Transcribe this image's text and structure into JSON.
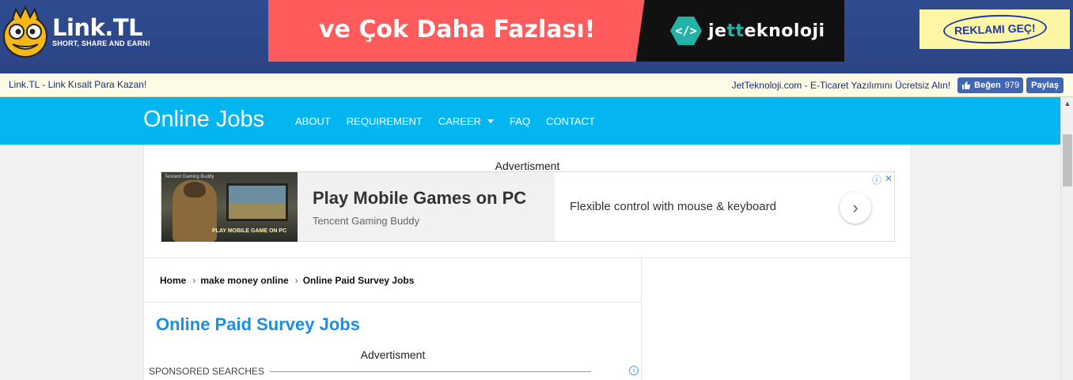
{
  "linktl": {
    "logo_title": "Link.TL",
    "logo_tagline": "SHORT, SHARE AND EARN!",
    "banner": {
      "headline": "ve Çok Daha Fazlası!",
      "brand_icon": "</>",
      "brand_pre": "je",
      "brand_accent": "tt",
      "brand_post": "eknoloji"
    },
    "skip_ad_label": "REKLAMI GEÇ!",
    "subbar_left": "Link.TL - Link Kısalt Para Kazan!",
    "subbar_link": "JetTeknoloji.com",
    "subbar_text": " - E-Ticaret Yazılımını Ücretsiz Alın!",
    "fb_like_label": "Beğen",
    "fb_like_count": "979",
    "fb_share_label": "Paylaş"
  },
  "site": {
    "brand": "Online Jobs",
    "nav": [
      {
        "label": "ABOUT"
      },
      {
        "label": "REQUIREMENT"
      },
      {
        "label": "CAREER",
        "has_dropdown": true
      },
      {
        "label": "FAQ"
      },
      {
        "label": "CONTACT"
      }
    ]
  },
  "top_ad": {
    "label": "Advertisment",
    "thumb_top_text": "Tencent Gaming Buddy",
    "thumb_caption": "PLAY MOBILE GAME ON PC",
    "title": "Play Mobile Games on PC",
    "subtitle": "Tencent Gaming Buddy",
    "description": "Flexible control with mouse & keyboard",
    "arrow_icon": "›",
    "info_icon": "ⓘ",
    "close_icon": "✕"
  },
  "breadcrumb": [
    "Home",
    "make money online",
    "Online Paid Survey Jobs"
  ],
  "breadcrumb_separator": "›",
  "post": {
    "title": "Online Paid Survey Jobs",
    "ad_label": "Advertisment",
    "sponsored_label": "SPONSORED SEARCHES",
    "info_icon": "i"
  },
  "colors": {
    "linktl_bar": "#2e4a8d",
    "nav_bar": "#03b6ef",
    "title_blue": "#1e8ee0",
    "banner_red": "#ff5b5d"
  },
  "scrollbar": {
    "up_icon": "▲"
  }
}
